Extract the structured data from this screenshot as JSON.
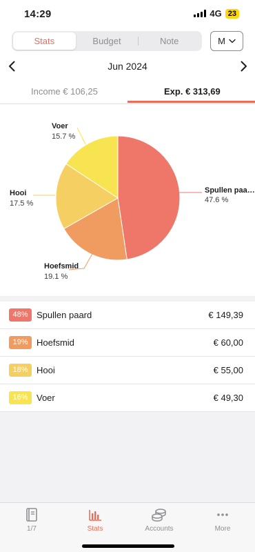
{
  "status_bar": {
    "time": "14:29",
    "network": "4G",
    "battery": "23"
  },
  "header": {
    "segments": [
      "Stats",
      "Budget",
      "Note"
    ],
    "active_segment": "Stats",
    "period_selector": "M",
    "month_label": "Jun 2024",
    "tabs": {
      "income": "Income € 106,25",
      "expense": "Exp. € 313,69"
    },
    "active_tab": "expense"
  },
  "chart_data": {
    "type": "pie",
    "slices": [
      {
        "label": "Spullen paard",
        "display_label": "Spullen paa…",
        "percent_text": "47.6 %",
        "value": 47.6,
        "color": "#ee776a"
      },
      {
        "label": "Hoefsmid",
        "display_label": "Hoefsmid",
        "percent_text": "19.1 %",
        "value": 19.1,
        "color": "#f09c60"
      },
      {
        "label": "Hooi",
        "display_label": "Hooi",
        "percent_text": "17.5 %",
        "value": 17.5,
        "color": "#f5cf62"
      },
      {
        "label": "Voer",
        "display_label": "Voer",
        "percent_text": "15.7 %",
        "value": 15.7,
        "color": "#f8e451"
      }
    ]
  },
  "categories": [
    {
      "badge": "48%",
      "name": "Spullen paard",
      "amount": "€ 149,39",
      "color": "#ee776a"
    },
    {
      "badge": "19%",
      "name": "Hoefsmid",
      "amount": "€ 60,00",
      "color": "#f09c60"
    },
    {
      "badge": "18%",
      "name": "Hooi",
      "amount": "€ 55,00",
      "color": "#f5cf62"
    },
    {
      "badge": "16%",
      "name": "Voer",
      "amount": "€ 49,30",
      "color": "#f8e451"
    }
  ],
  "tabbar": {
    "items": [
      {
        "label": "1/7",
        "icon": "book-icon"
      },
      {
        "label": "Stats",
        "icon": "bar-chart-icon"
      },
      {
        "label": "Accounts",
        "icon": "coins-icon"
      },
      {
        "label": "More",
        "icon": "more-dots-icon"
      }
    ],
    "active": "Stats"
  },
  "colors": {
    "accent": "#ee6b57",
    "inactive": "#8e8e93"
  }
}
